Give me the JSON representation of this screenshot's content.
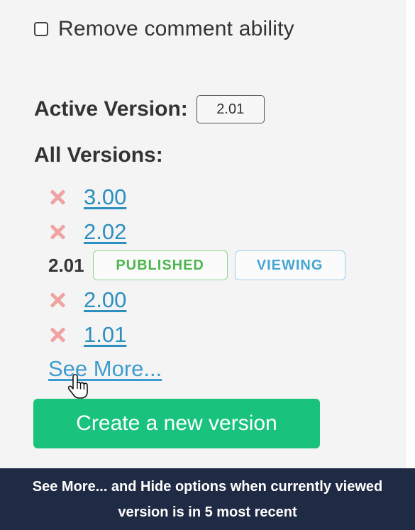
{
  "settings": {
    "remove_comment_label": "Remove comment ability",
    "remove_comment_checked": false
  },
  "active_version": {
    "label": "Active Version:",
    "value": "2.01"
  },
  "all_versions": {
    "label": "All Versions:",
    "items": [
      {
        "version": "3.00",
        "deletable": true,
        "link": true
      },
      {
        "version": "2.02",
        "deletable": true,
        "link": true
      },
      {
        "version": "2.01",
        "deletable": false,
        "link": false,
        "tags": [
          "PUBLISHED",
          "VIEWING"
        ]
      },
      {
        "version": "2.00",
        "deletable": true,
        "link": true
      },
      {
        "version": "1.01",
        "deletable": true,
        "link": true
      }
    ],
    "see_more_label": "See More..."
  },
  "create_button_label": "Create a new version",
  "caption": "See More... and Hide options when currently viewed version is in 5 most recent",
  "colors": {
    "accent_green": "#19c37d",
    "link_blue": "#2c8fc0",
    "delete_red": "#f0a3a3",
    "published_green": "#4cb64c",
    "viewing_blue": "#45a5d4",
    "caption_bg": "#1f2a44"
  },
  "icons": {
    "delete": "x-icon",
    "cursor": "hand-pointer-icon"
  }
}
